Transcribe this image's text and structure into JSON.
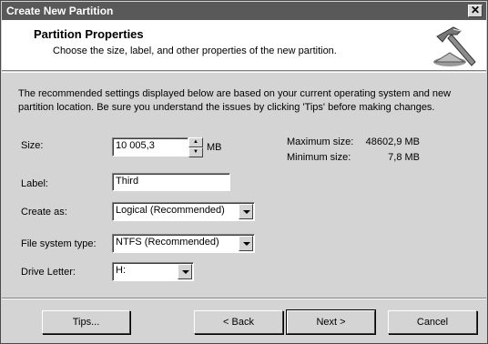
{
  "window": {
    "title": "Create New Partition",
    "close_glyph": "✕"
  },
  "header": {
    "title": "Partition Properties",
    "subtitle": "Choose the size, label, and other properties of the new partition."
  },
  "description": "The recommended settings displayed below are based on your current operating system and new partition location. Be sure you understand the issues by clicking 'Tips' before making changes.",
  "size": {
    "label": "Size:",
    "value": "10 005,3",
    "unit": "MB"
  },
  "limits": {
    "max_label": "Maximum size:",
    "max_value": "48602,9 MB",
    "min_label": "Minimum size:",
    "min_value": "7,8 MB"
  },
  "label_field": {
    "label": "Label:",
    "value": "Third"
  },
  "create_as": {
    "label": "Create as:",
    "selected": "Logical (Recommended)"
  },
  "file_system": {
    "label": "File system type:",
    "selected": "NTFS (Recommended)"
  },
  "drive_letter": {
    "label": "Drive Letter:",
    "selected": "H:"
  },
  "buttons": {
    "tips": "Tips...",
    "back": "< Back",
    "next": "Next >",
    "cancel": "Cancel"
  },
  "icons": {
    "header": "hammer-icon"
  }
}
